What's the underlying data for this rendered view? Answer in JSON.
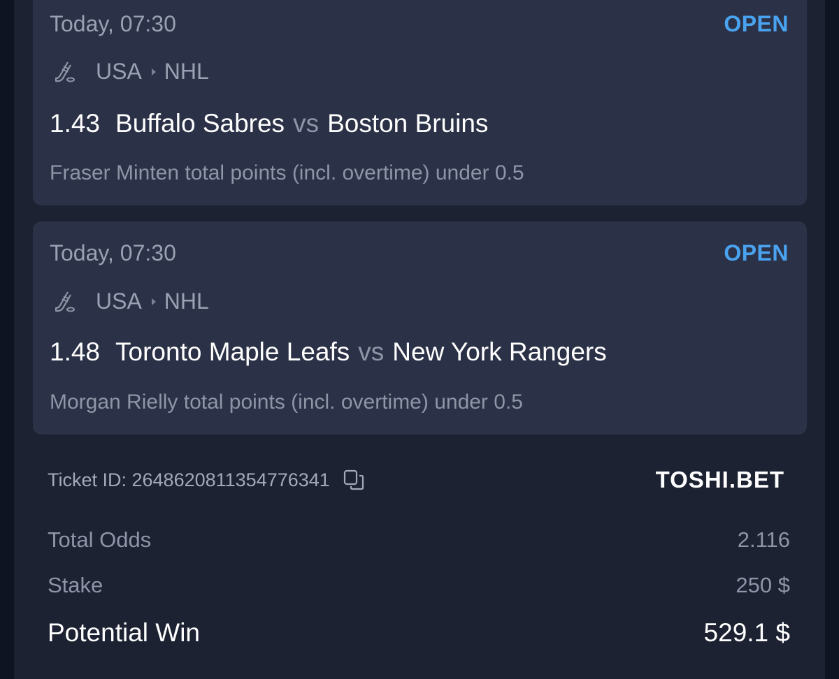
{
  "bets": [
    {
      "time": "Today, 07:30",
      "status": "OPEN",
      "country": "USA",
      "league": "NHL",
      "icon": "hockey-icon",
      "odds": "1.43",
      "home": "Buffalo Sabres",
      "vs": "vs",
      "away": "Boston Bruins",
      "market": "Fraser Minten total points (incl. overtime) under 0.5"
    },
    {
      "time": "Today, 07:30",
      "status": "OPEN",
      "country": "USA",
      "league": "NHL",
      "icon": "hockey-icon",
      "odds": "1.48",
      "home": "Toronto Maple Leafs",
      "vs": "vs",
      "away": "New York Rangers",
      "market": "Morgan Rielly total points (incl. overtime) under 0.5"
    }
  ],
  "ticket": {
    "label": "Ticket ID: 2648620811354776341",
    "copy_icon": "copy-icon"
  },
  "brand": "TOSHI.BET",
  "summary": {
    "total_odds_label": "Total Odds",
    "total_odds_value": "2.116",
    "stake_label": "Stake",
    "stake_value": "250 $",
    "potential_win_label": "Potential Win",
    "potential_win_value": "529.1 $"
  },
  "colors": {
    "background": "#0f1423",
    "panel": "#1d2233",
    "card": "#2b3146",
    "accent": "#4aa3f0"
  }
}
